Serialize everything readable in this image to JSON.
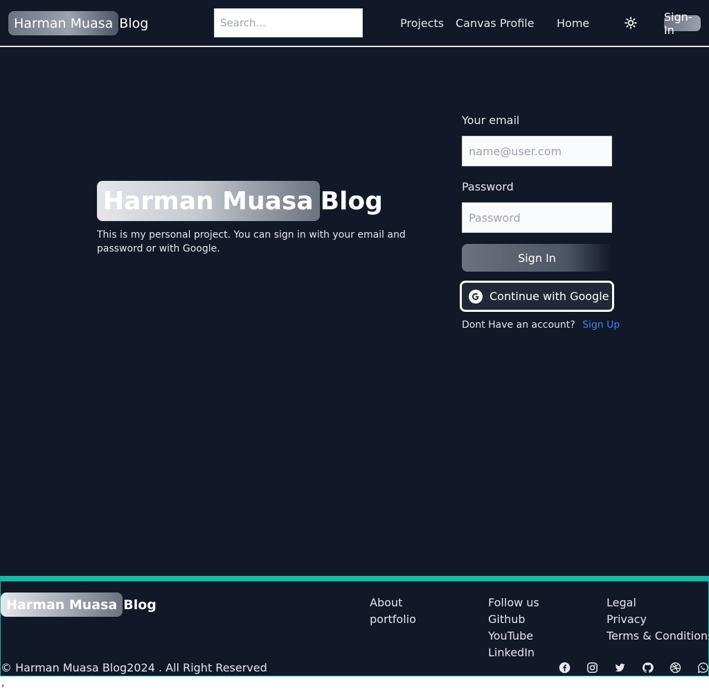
{
  "navbar": {
    "brand_highlight": "Harman Muasa",
    "brand_rest": "Blog",
    "search_placeholder": "Search...",
    "links": [
      "Projects",
      "Canvas Profile",
      "Home"
    ],
    "theme_icon": "sun-icon",
    "signin_label": "Sign-In"
  },
  "hero": {
    "title_highlight": "Harman Muasa",
    "title_rest": "Blog",
    "description": "This is my personal project. You can sign in with your email and password or with Google."
  },
  "form": {
    "email_label": "Your email",
    "email_placeholder": "name@user.com",
    "password_label": "Password",
    "password_placeholder": "Password",
    "signin_button": "Sign In",
    "google_button": "Continue with Google",
    "google_icon": "google-icon",
    "no_account_text": "Dont Have an account?",
    "signup_link": "Sign Up"
  },
  "footer": {
    "brand_highlight": "Harman Muasa",
    "brand_rest": "Blog",
    "about": {
      "title": "About",
      "items": [
        "portfolio"
      ]
    },
    "follow": {
      "title": "Follow us",
      "items": [
        "Github",
        "YouTube",
        "LinkedIn"
      ]
    },
    "legal": {
      "title": "Legal",
      "items": [
        "Privacy",
        "Terms & Conditions"
      ]
    },
    "copyright": "© Harman Muasa Blog2024 . All Right Reserved",
    "social_icons": [
      "facebook-icon",
      "instagram-icon",
      "twitter-icon",
      "github-icon",
      "dribbble-icon",
      "whatsapp-icon"
    ]
  },
  "stray_char": ","
}
